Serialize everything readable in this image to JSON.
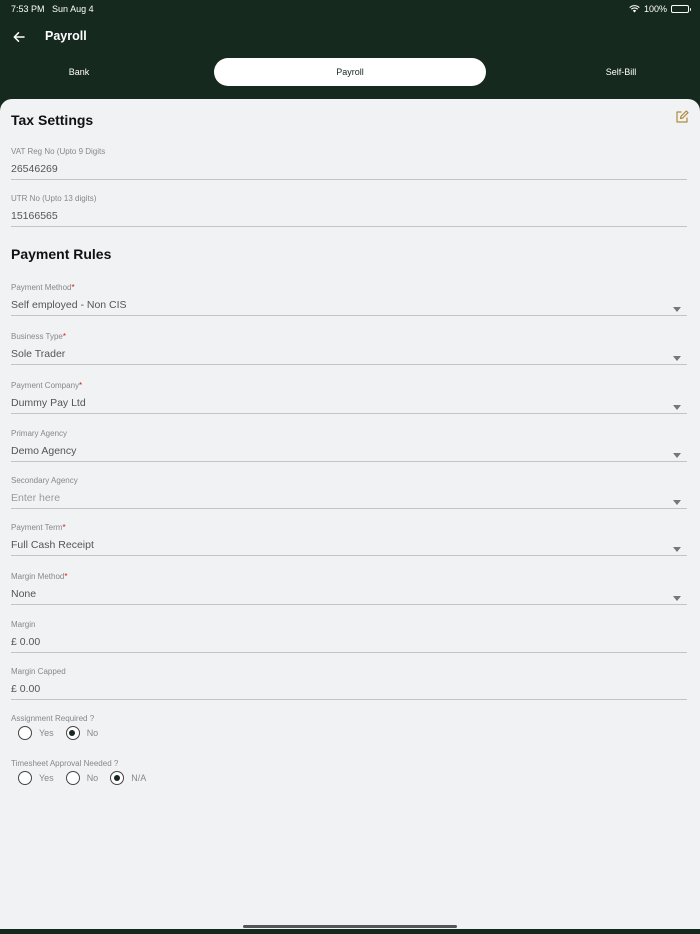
{
  "status_bar": {
    "time": "7:53 PM",
    "date": "Sun Aug 4",
    "battery": "100%",
    "icons": [
      "wifi-icon",
      "battery-icon"
    ]
  },
  "nav": {
    "title": "Payroll",
    "back_icon": "arrow-left-icon"
  },
  "tabs": [
    {
      "label": "Bank",
      "active": false
    },
    {
      "label": "Payroll",
      "active": true
    },
    {
      "label": "Self-Bill",
      "active": false
    }
  ],
  "tax_settings": {
    "title": "Tax Settings",
    "edit_icon": "edit-icon",
    "vat": {
      "label": "VAT Reg No (Upto 9 Digits",
      "value": "26546269"
    },
    "utr": {
      "label": "UTR No (Upto 13 digits)",
      "value": "15166565"
    }
  },
  "payment_rules": {
    "title": "Payment Rules",
    "payment_method": {
      "label": "Payment Method",
      "required": "*",
      "value": "Self employed - Non CIS"
    },
    "business_type": {
      "label": "Business Type",
      "required": "*",
      "value": "Sole Trader"
    },
    "payment_company": {
      "label": "Payment Company",
      "required": "*",
      "value": "Dummy Pay Ltd"
    },
    "primary_agency": {
      "label": "Primary Agency",
      "value": "Demo Agency"
    },
    "secondary_agency": {
      "label": "Secondary Agency",
      "placeholder": "Enter here"
    },
    "payment_term": {
      "label": "Payment Term",
      "required": "*",
      "value": "Full Cash Receipt"
    },
    "margin_method": {
      "label": "Margin Method",
      "required": "*",
      "value": "None"
    },
    "margin": {
      "label": "Margin",
      "value": "£ 0.00"
    },
    "margin_capped": {
      "label": "Margin Capped",
      "value": "£ 0.00"
    },
    "assignment_required": {
      "label": "Assignment Required ?",
      "options": [
        "Yes",
        "No"
      ],
      "selected": "No"
    },
    "timesheet_approval": {
      "label": "Timesheet Approval Needed ?",
      "options": [
        "Yes",
        "No",
        "N/A"
      ],
      "selected": "N/A"
    }
  },
  "colors": {
    "header_bg": "#16291f",
    "content_bg": "#f1f2f4",
    "required": "#d21a1a",
    "edit_icon": "#b08a3e"
  }
}
